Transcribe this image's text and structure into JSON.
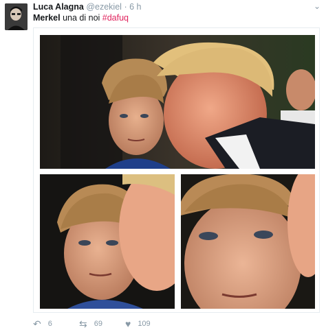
{
  "author": {
    "display_name": "Luca Alagna",
    "handle": "@ezekiel",
    "separator": "·",
    "time": "6 h"
  },
  "tweet": {
    "text_bold": "Merkel",
    "text_rest": " una di noi ",
    "hashtag": "#dafuq"
  },
  "actions": {
    "reply_count": "6",
    "retweet_count": "69",
    "like_count": "109"
  },
  "icons": {
    "menu": "chevron-down-icon",
    "reply": "reply-icon",
    "retweet": "retweet-icon",
    "like": "heart-icon"
  },
  "colors": {
    "name": "#14171a",
    "muted": "#8899a6",
    "hashtag": "#e0245e"
  }
}
